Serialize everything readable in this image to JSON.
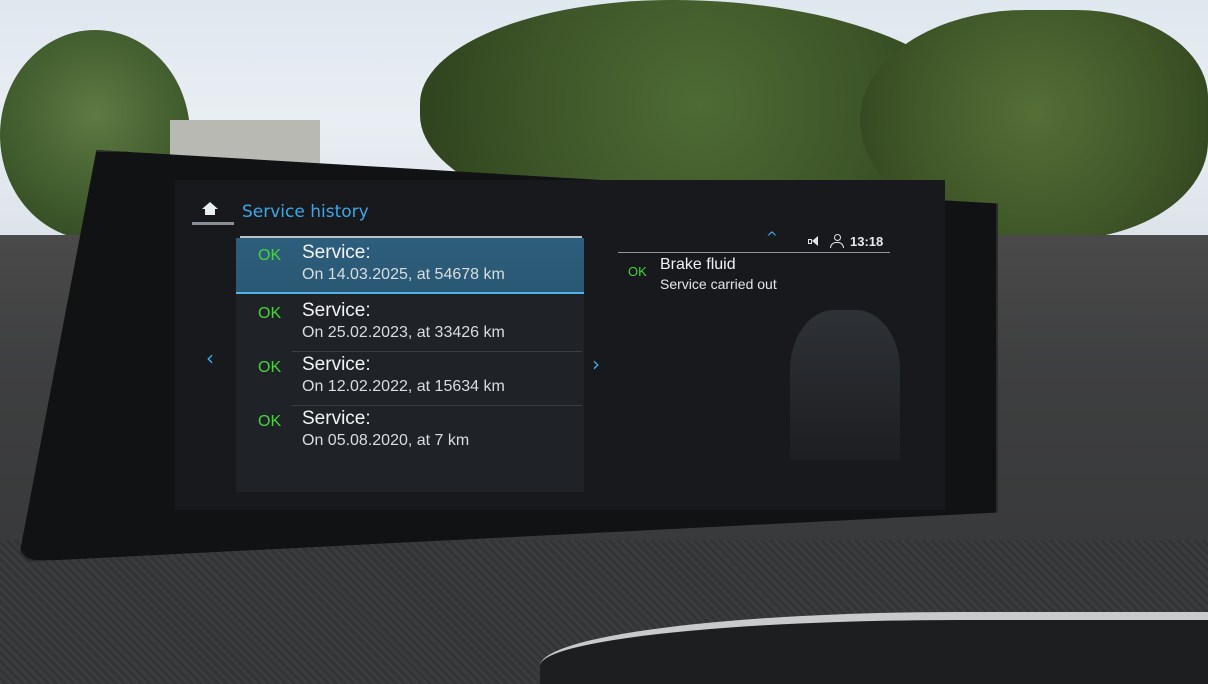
{
  "header": {
    "title": "Service history"
  },
  "service_list": [
    {
      "status": "OK",
      "title": "Service:",
      "detail": "On 14.03.2025, at 54678 km",
      "selected": true
    },
    {
      "status": "OK",
      "title": "Service:",
      "detail": "On 25.02.2023, at 33426 km",
      "selected": false
    },
    {
      "status": "OK",
      "title": "Service:",
      "detail": "On 12.02.2022, at 15634 km",
      "selected": false
    },
    {
      "status": "OK",
      "title": "Service:",
      "detail": "On 05.08.2020, at 7 km",
      "selected": false
    }
  ],
  "nav": {
    "left_arrow": "‹",
    "right_arrow": "›"
  },
  "status_bar": {
    "up_arrow": "^",
    "time": "13:18",
    "icons": [
      "speaker-icon",
      "user-icon"
    ]
  },
  "detail_panel": {
    "status": "OK",
    "title": "Brake fluid",
    "subtitle": "Service carried out"
  },
  "colors": {
    "accent": "#3ea7e8",
    "ok_green": "#46d63a",
    "selected_row": "#2d5e7c"
  }
}
